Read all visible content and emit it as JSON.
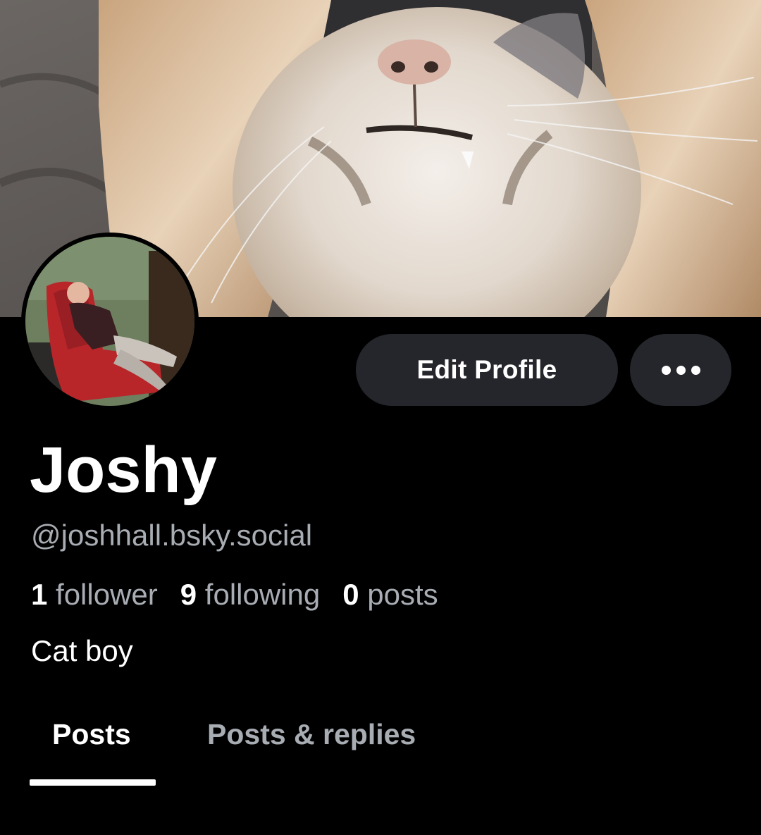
{
  "banner": {
    "description_icon": "banner-photo"
  },
  "avatar": {
    "icon": "avatar-photo"
  },
  "actions": {
    "edit_profile_label": "Edit Profile",
    "more_icon": "ellipsis-icon"
  },
  "profile": {
    "display_name": "Joshy",
    "handle": "@joshhall.bsky.social",
    "bio": "Cat boy"
  },
  "stats": {
    "followers_count": "1",
    "followers_label": "follower",
    "following_count": "9",
    "following_label": "following",
    "posts_count": "0",
    "posts_label": "posts"
  },
  "tabs": [
    {
      "label": "Posts",
      "active": true
    },
    {
      "label": "Posts & replies",
      "active": false
    }
  ],
  "colors": {
    "background": "#000000",
    "button_bg": "#25262b",
    "muted_text": "#a8acb3",
    "primary_text": "#ffffff"
  }
}
